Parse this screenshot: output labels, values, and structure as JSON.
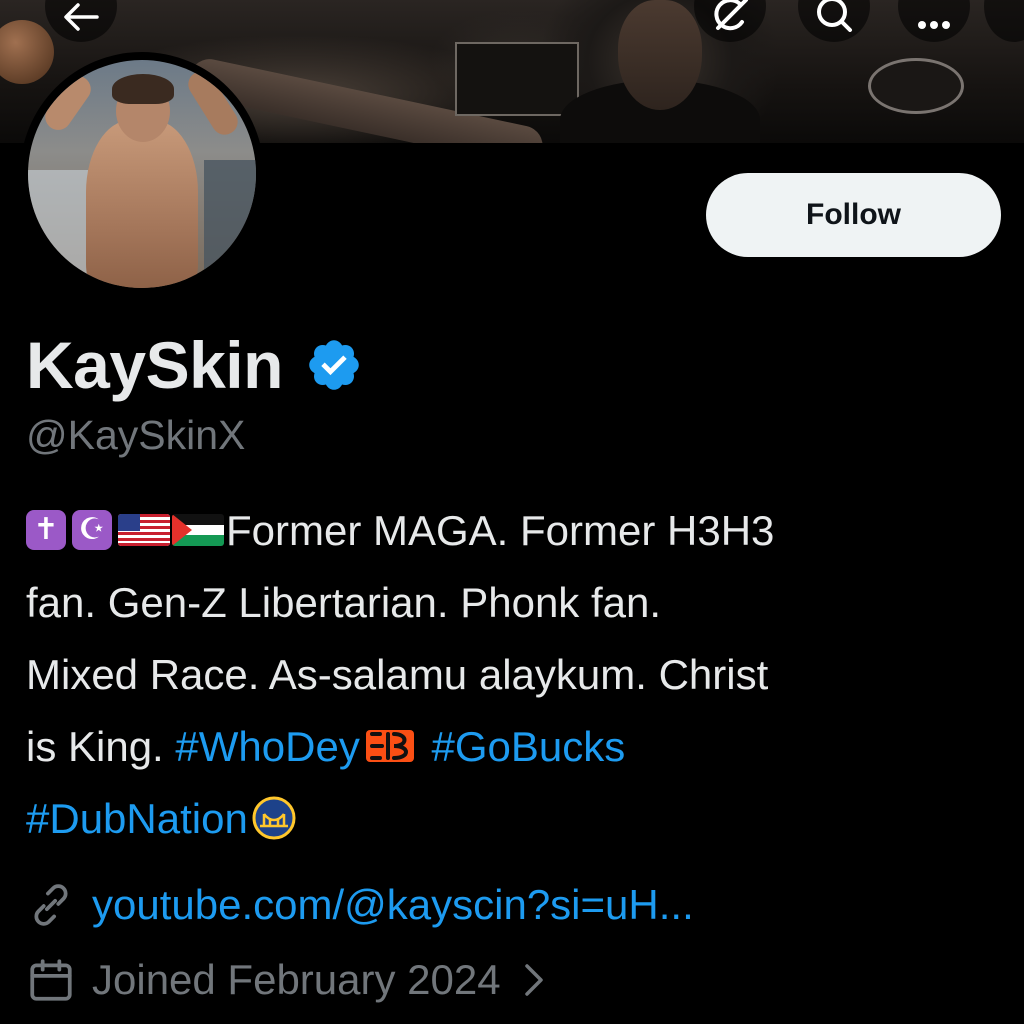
{
  "header": {
    "icons": {
      "back": "back-arrow-icon",
      "grok": "grok-icon",
      "search": "search-icon",
      "more": "more-icon"
    }
  },
  "profile": {
    "follow_label": "Follow",
    "display_name": "KaySkin",
    "verified": true,
    "handle": "@KaySkinX",
    "bio": {
      "line1_text": "Former MAGA. Former H3H3",
      "line2_text": "fan. Gen-Z Libertarian. Phonk fan.",
      "line3_text": "Mixed Race. As-salamu alaykum. Christ",
      "line4_text": "is King.",
      "hashtag_whodey": "#WhoDey",
      "hashtag_gobucks": "#GoBucks",
      "hashtag_dubnation": "#DubNation",
      "emojis": [
        "latin-cross-emoji",
        "star-and-crescent-emoji",
        "us-flag-emoji",
        "palestine-flag-emoji",
        "bengals-logo-emoji",
        "warriors-logo-emoji"
      ],
      "cross_glyph": "✝",
      "crescent_glyph": "☪"
    },
    "link": "youtube.com/@kayscin?si=uH...",
    "joined": "Joined February 2024"
  },
  "colors": {
    "background": "#000000",
    "text_primary": "#e7e9ea",
    "text_secondary": "#71767b",
    "accent_blue": "#1d9bf0",
    "follow_button_bg": "#eff3f4"
  }
}
